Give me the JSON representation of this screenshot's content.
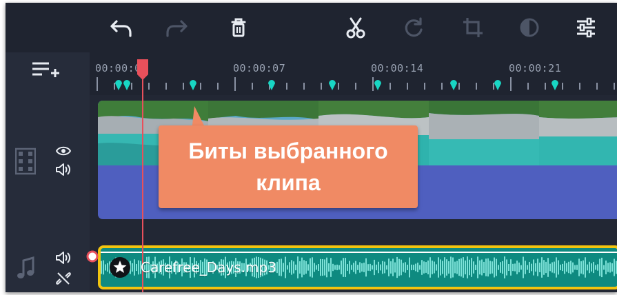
{
  "toolbar": {
    "buttons": [
      {
        "name": "undo",
        "icon": "undo-icon",
        "enabled": true
      },
      {
        "name": "redo",
        "icon": "redo-icon",
        "enabled": false
      },
      {
        "name": "delete",
        "icon": "trash-icon",
        "enabled": true
      },
      {
        "name": "cut",
        "icon": "scissors-icon",
        "enabled": true
      },
      {
        "name": "rotate",
        "icon": "rotate-icon",
        "enabled": false
      },
      {
        "name": "crop",
        "icon": "crop-icon",
        "enabled": false
      },
      {
        "name": "color-adjust",
        "icon": "contrast-icon",
        "enabled": false
      },
      {
        "name": "clip-properties",
        "icon": "sliders-icon",
        "enabled": true
      }
    ]
  },
  "ruler": {
    "labels": [
      "00:00:00",
      "00:00:07",
      "00:00:14",
      "00:00:21"
    ]
  },
  "tracks": {
    "video": {
      "icons": [
        "eye-icon",
        "volume-icon"
      ]
    },
    "audio": {
      "clip_name": "Carefree_Days.mp3",
      "icons": [
        "volume-icon",
        "unlink-icon"
      ]
    }
  },
  "callout": {
    "line1": "Биты выбранного",
    "line2": "клипа"
  },
  "colors": {
    "background": "#262c3a",
    "toolbar": "#1f2430",
    "video_track": "#4f5fbf",
    "audio_track": "#0e8a80",
    "audio_border": "#f2c40f",
    "beat_marker": "#18d6c4",
    "playhead": "#e8505b",
    "callout": "#f08a64"
  }
}
